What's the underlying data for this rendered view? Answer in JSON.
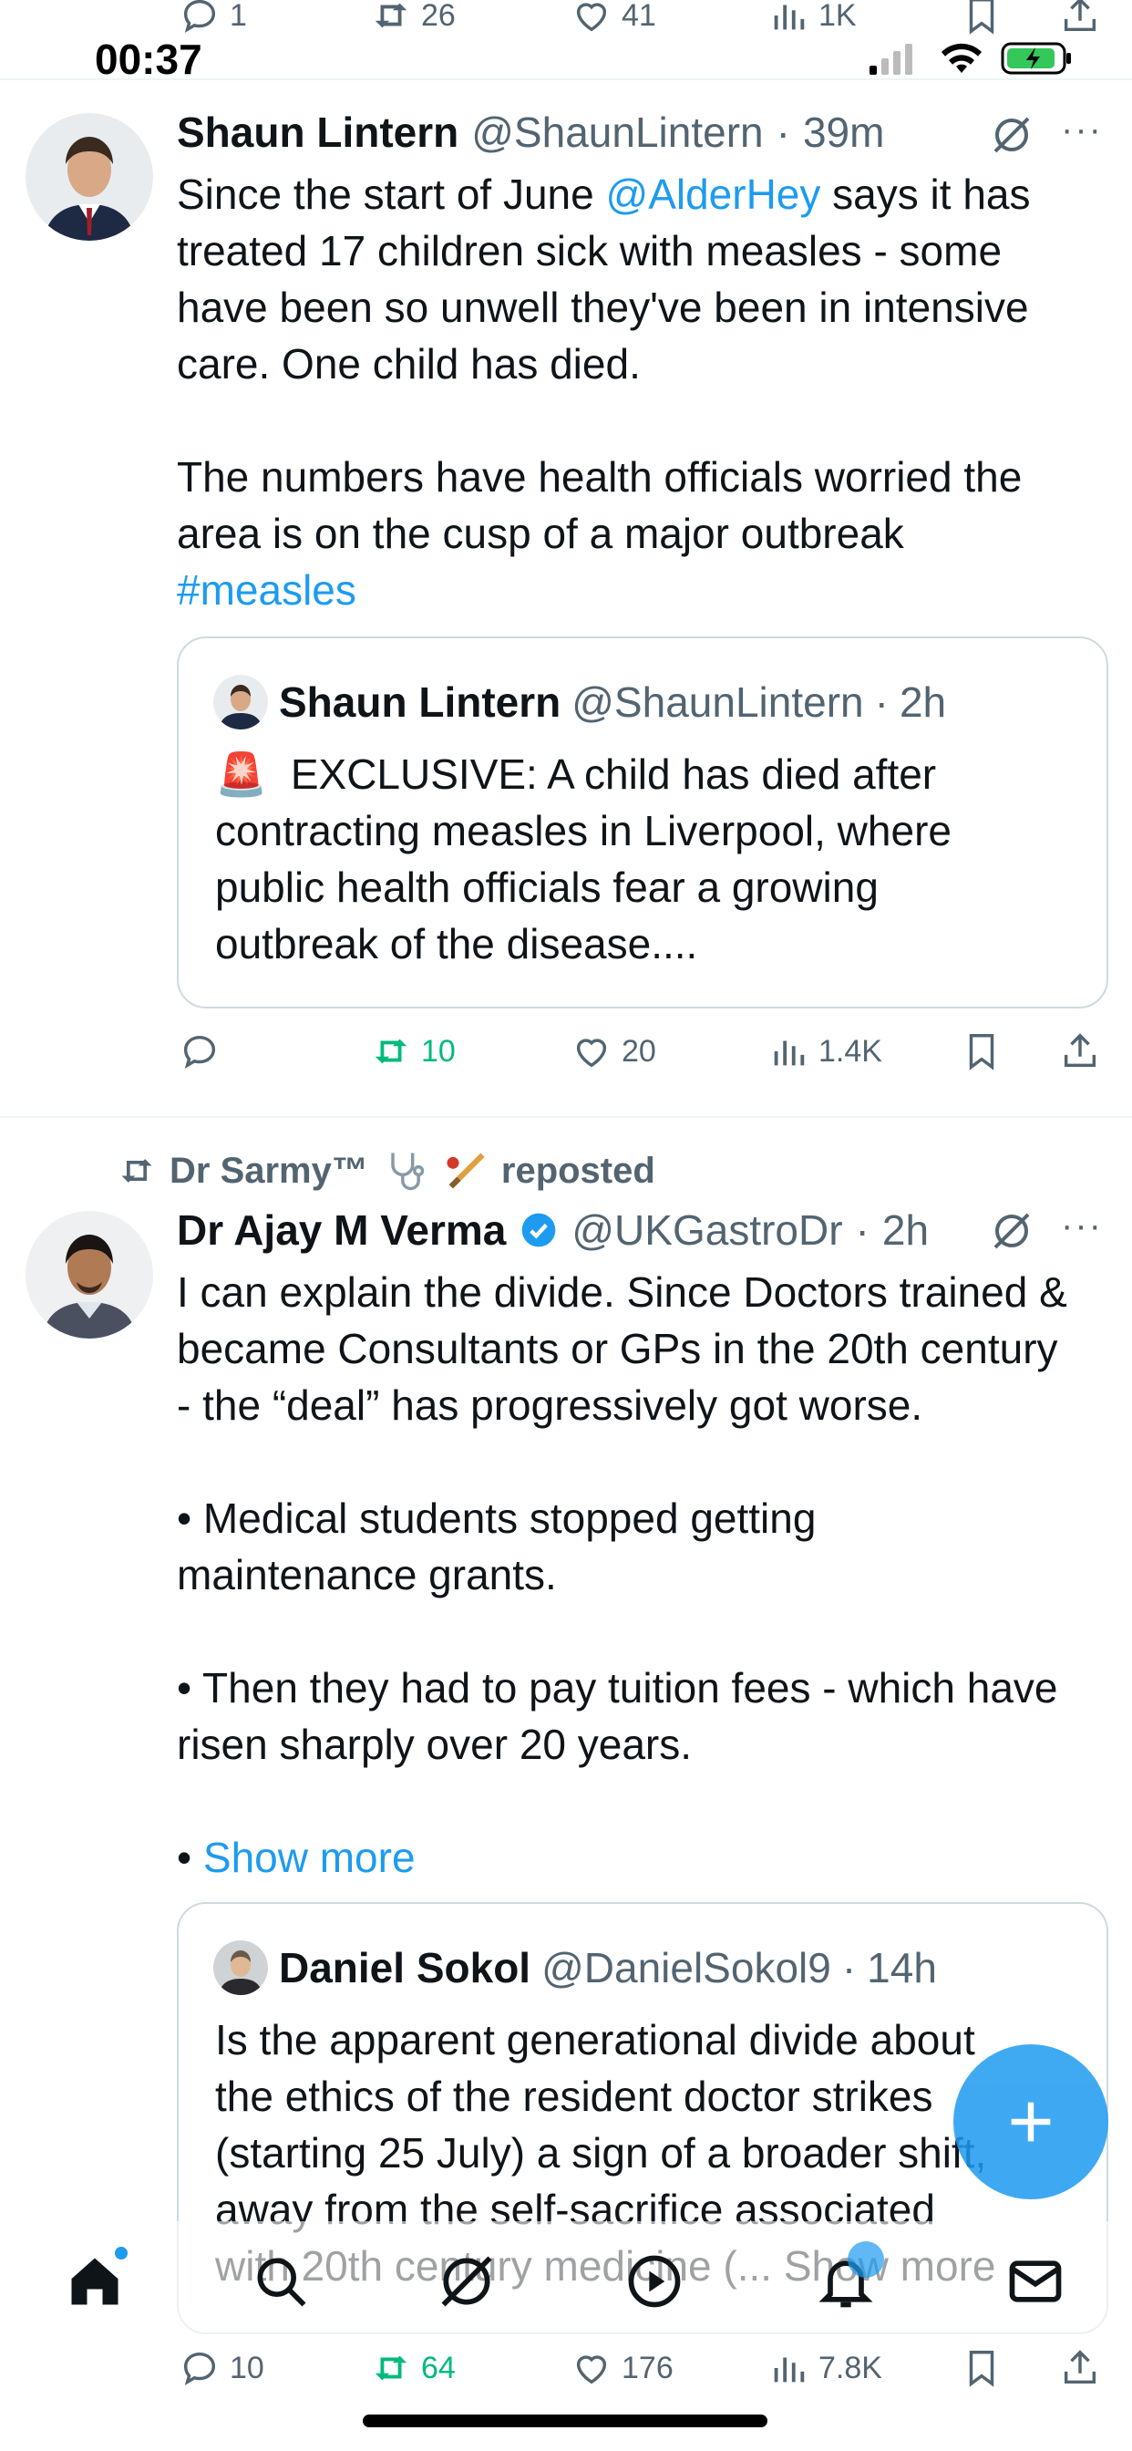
{
  "status_bar": {
    "time": "00:37"
  },
  "top_actions": {
    "replies": "1",
    "reposts": "26",
    "likes": "41",
    "views": "1K"
  },
  "tweets": [
    {
      "name": "Shaun Lintern",
      "handle": "@ShaunLintern",
      "time": "39m",
      "text_before_mention": "Since the start of June ",
      "mention": "@AlderHey",
      "text_after_mention": " says it has\ntreated 17 children sick with measles - some\nhave been so unwell they've been in intensive\ncare. One child has died.\n\nThe numbers have health officials worried the\narea is on the cusp of a major outbreak\n",
      "hashtag": "#measles",
      "quote": {
        "name": "Shaun Lintern",
        "handle": "@ShaunLintern",
        "time": "2h",
        "emoji": "🚨",
        "text": "EXCLUSIVE: A child has died after\ncontracting measles in Liverpool, where\npublic health officials fear a growing\noutbreak of the disease...."
      },
      "actions": {
        "replies": "",
        "reposts": "10",
        "likes": "20",
        "views": "1.4K"
      }
    },
    {
      "reposted_by": "Dr Sarmy™",
      "reposted_label": "reposted",
      "name": "Dr Ajay M Verma",
      "handle": "@UKGastroDr",
      "time": "2h",
      "text": "I can explain the divide. Since Doctors trained &\nbecame Consultants or GPs in the 20th century\n- the “deal” has progressively got worse.\n\n• Medical students stopped getting\nmaintenance grants.\n\n• Then they had to pay tuition fees - which have\nrisen sharply over 20 years.\n\n• ",
      "show_more": "Show more",
      "quote": {
        "name": "Daniel Sokol",
        "handle": "@DanielSokol9",
        "time": "14h",
        "text": "Is the apparent generational divide about\nthe ethics of the resident doctor strikes\n(starting 25 July) a sign of a broader shift,\naway from the self-sacrifice associated\nwith 20th century medicine (... Show more"
      },
      "actions": {
        "replies": "10",
        "reposts": "64",
        "likes": "176",
        "views": "7.8K"
      }
    }
  ],
  "separator": "·",
  "colors": {
    "accent": "#1d9bf0",
    "repost_green": "#00ba7c",
    "muted": "#536471"
  },
  "tabs": [
    "home-icon",
    "search-icon",
    "grok-icon",
    "video-icon",
    "notifications-icon",
    "messages-icon"
  ]
}
